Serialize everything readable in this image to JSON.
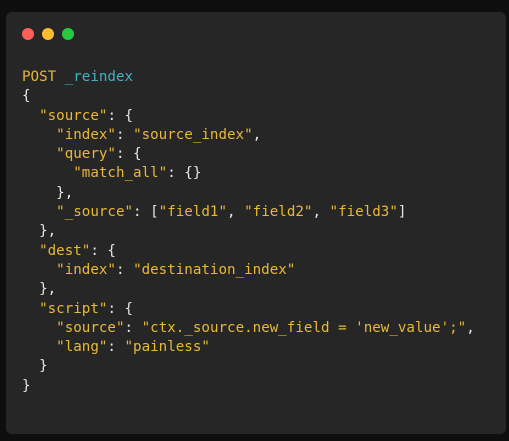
{
  "window": {
    "traffic_lights": [
      "close",
      "minimize",
      "zoom"
    ]
  },
  "colors": {
    "background": "#262626",
    "keyword": "#e8b935",
    "path": "#3fb3c2",
    "punctuation": "#e6e6e6"
  },
  "code": {
    "method": "POST",
    "path": "_reindex",
    "lines": [
      [
        {
          "t": "method",
          "v": "POST"
        },
        {
          "t": "punc",
          "v": " "
        },
        {
          "t": "path",
          "v": "_reindex"
        }
      ],
      [
        {
          "t": "punc",
          "v": "{"
        }
      ],
      [
        {
          "t": "punc",
          "v": "  "
        },
        {
          "t": "key",
          "v": "\"source\""
        },
        {
          "t": "punc",
          "v": ": {"
        }
      ],
      [
        {
          "t": "punc",
          "v": "    "
        },
        {
          "t": "key",
          "v": "\"index\""
        },
        {
          "t": "punc",
          "v": ": "
        },
        {
          "t": "str",
          "v": "\"source_index\""
        },
        {
          "t": "punc",
          "v": ","
        }
      ],
      [
        {
          "t": "punc",
          "v": "    "
        },
        {
          "t": "key",
          "v": "\"query\""
        },
        {
          "t": "punc",
          "v": ": {"
        }
      ],
      [
        {
          "t": "punc",
          "v": "      "
        },
        {
          "t": "key",
          "v": "\"match_all\""
        },
        {
          "t": "punc",
          "v": ": {}"
        }
      ],
      [
        {
          "t": "punc",
          "v": "    },"
        }
      ],
      [
        {
          "t": "punc",
          "v": "    "
        },
        {
          "t": "key",
          "v": "\"_source\""
        },
        {
          "t": "punc",
          "v": ": ["
        },
        {
          "t": "str",
          "v": "\"field1\""
        },
        {
          "t": "punc",
          "v": ", "
        },
        {
          "t": "str",
          "v": "\"field2\""
        },
        {
          "t": "punc",
          "v": ", "
        },
        {
          "t": "str",
          "v": "\"field3\""
        },
        {
          "t": "punc",
          "v": "]"
        }
      ],
      [
        {
          "t": "punc",
          "v": "  },"
        }
      ],
      [
        {
          "t": "punc",
          "v": "  "
        },
        {
          "t": "key",
          "v": "\"dest\""
        },
        {
          "t": "punc",
          "v": ": {"
        }
      ],
      [
        {
          "t": "punc",
          "v": "    "
        },
        {
          "t": "key",
          "v": "\"index\""
        },
        {
          "t": "punc",
          "v": ": "
        },
        {
          "t": "str",
          "v": "\"destination_index\""
        }
      ],
      [
        {
          "t": "punc",
          "v": "  },"
        }
      ],
      [
        {
          "t": "punc",
          "v": "  "
        },
        {
          "t": "key",
          "v": "\"script\""
        },
        {
          "t": "punc",
          "v": ": {"
        }
      ],
      [
        {
          "t": "punc",
          "v": "    "
        },
        {
          "t": "key",
          "v": "\"source\""
        },
        {
          "t": "punc",
          "v": ": "
        },
        {
          "t": "str",
          "v": "\"ctx._source.new_field = 'new_value';\""
        },
        {
          "t": "punc",
          "v": ","
        }
      ],
      [
        {
          "t": "punc",
          "v": "    "
        },
        {
          "t": "key",
          "v": "\"lang\""
        },
        {
          "t": "punc",
          "v": ": "
        },
        {
          "t": "str",
          "v": "\"painless\""
        }
      ],
      [
        {
          "t": "punc",
          "v": "  }"
        }
      ],
      [
        {
          "t": "punc",
          "v": "}"
        }
      ]
    ]
  }
}
